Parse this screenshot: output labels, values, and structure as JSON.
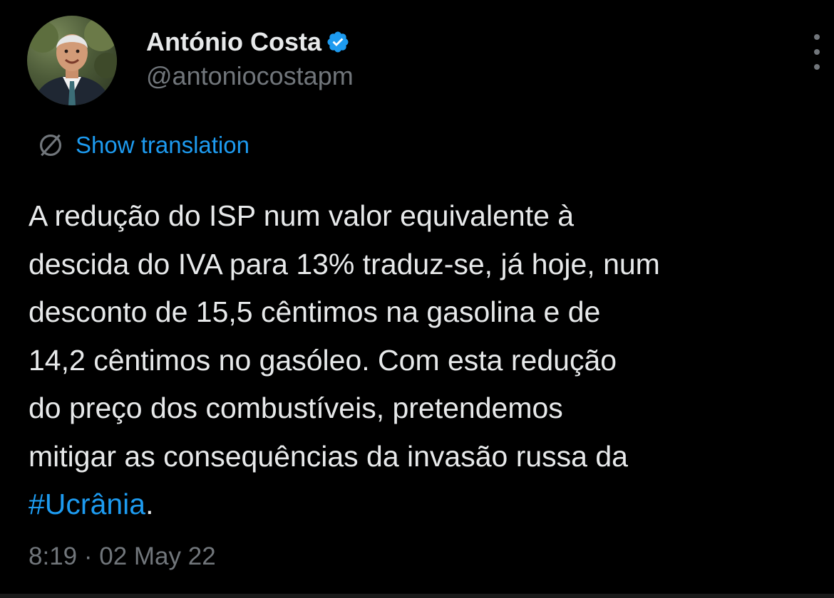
{
  "author": {
    "display_name": "António Costa",
    "handle": "@antoniocostapm",
    "verified": true
  },
  "translate": {
    "label": "Show translation",
    "icon": "globe-icon"
  },
  "tweet": {
    "lines": [
      "A redução do ISP num valor equivalente à",
      "descida do IVA para 13% traduz-se, já hoje, num",
      "desconto de 15,5 cêntimos na gasolina e de",
      "14,2 cêntimos no gasóleo. Com esta redução",
      "do preço dos combustíveis, pretendemos",
      "mitigar as consequências da invasão russa da"
    ],
    "hashtag": "#Ucrânia",
    "after_hashtag": "."
  },
  "meta": {
    "timestamp": "8:19 · 02 May 22"
  },
  "colors": {
    "background": "#000000",
    "text": "#e7e9ea",
    "secondary": "#71767b",
    "accent": "#1d9bf0"
  }
}
